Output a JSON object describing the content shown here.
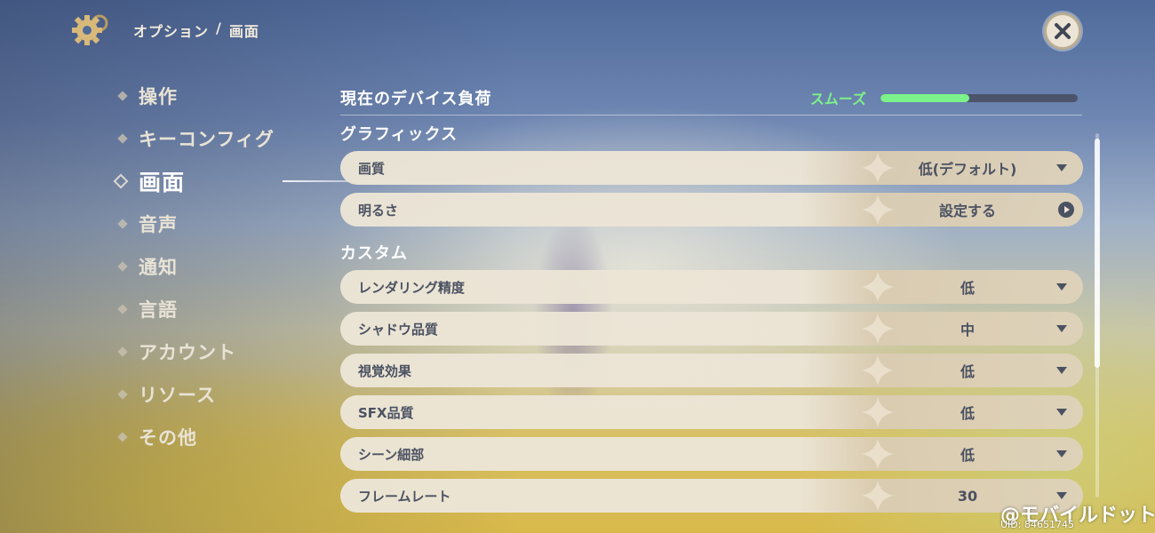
{
  "header": {
    "breadcrumb_root": "オプション",
    "breadcrumb_sep": "/",
    "breadcrumb_current": "画面"
  },
  "sidebar": {
    "items": [
      {
        "label": "操作"
      },
      {
        "label": "キーコンフィグ"
      },
      {
        "label": "画面",
        "active": true
      },
      {
        "label": "音声"
      },
      {
        "label": "通知"
      },
      {
        "label": "言語"
      },
      {
        "label": "アカウント"
      },
      {
        "label": "リソース"
      },
      {
        "label": "その他"
      }
    ]
  },
  "device_load": {
    "label": "現在のデバイス負荷",
    "status": "スムーズ",
    "level_fraction": 0.45,
    "status_color": "#7cf28a"
  },
  "graphics": {
    "title": "グラフィックス",
    "rows": [
      {
        "name": "画質",
        "value": "低(デフォルト)",
        "control": "dropdown"
      },
      {
        "name": "明るさ",
        "value": "設定する",
        "control": "link"
      }
    ]
  },
  "custom": {
    "title": "カスタム",
    "rows": [
      {
        "name": "レンダリング精度",
        "value": "低",
        "control": "dropdown"
      },
      {
        "name": "シャドウ品質",
        "value": "中",
        "control": "dropdown"
      },
      {
        "name": "視覚効果",
        "value": "低",
        "control": "dropdown"
      },
      {
        "name": "SFX品質",
        "value": "低",
        "control": "dropdown"
      },
      {
        "name": "シーン細部",
        "value": "低",
        "control": "dropdown"
      },
      {
        "name": "フレームレート",
        "value": "30",
        "control": "dropdown"
      }
    ]
  },
  "icons": {
    "settings": "gear-icon",
    "close": "close-icon"
  },
  "watermark": {
    "text": "@モバイルドットコム",
    "uid": "UID: 84651745"
  }
}
